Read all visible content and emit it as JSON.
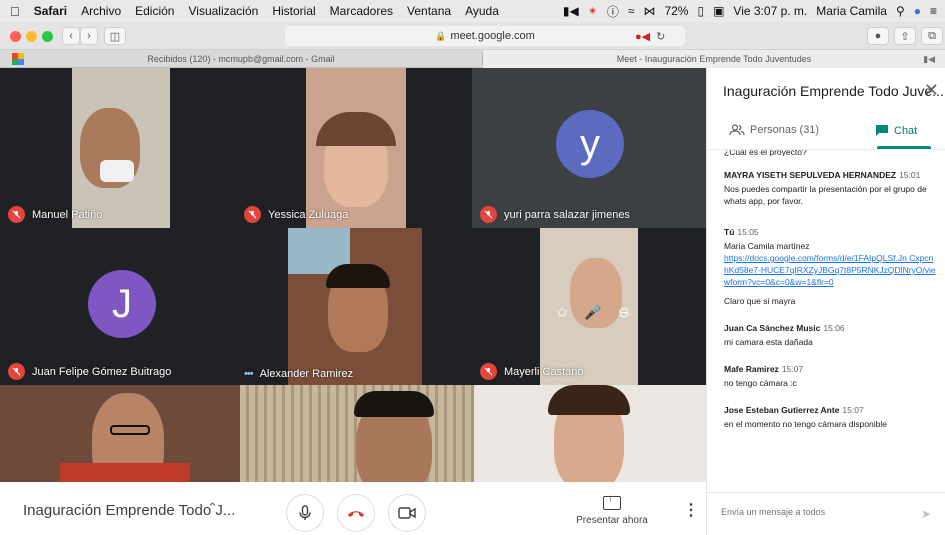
{
  "menubar": {
    "app": "Safari",
    "items": [
      "Archivo",
      "Edición",
      "Visualización",
      "Historial",
      "Marcadores",
      "Ventana",
      "Ayuda"
    ],
    "battery": "72%",
    "time": "Vie 3:07 p. m.",
    "user": "Maria Camila"
  },
  "browser": {
    "url": "meet.google.com",
    "tabs": [
      {
        "label": "Recibidos (120) - mcmupb@gmail.com - Gmail"
      },
      {
        "label": "Meet - Inauguración Emprende Todo Juventudes"
      }
    ]
  },
  "participants": [
    {
      "name": "Manuel Patiño"
    },
    {
      "name": "Yessica Zuluaga"
    },
    {
      "name": "yuri parra salazar jimenes",
      "initial": "y",
      "avatar_color": "#5c6bc0"
    },
    {
      "name": "Juan Felipe Gómez Buitrago",
      "initial": "J",
      "avatar_color": "#7e57c2"
    },
    {
      "name": "Alexander Ramirez"
    },
    {
      "name": "Mayerli Castano"
    }
  ],
  "bottombar": {
    "meeting_title": "Inaguración Emprende Todo J...",
    "present_label": "Presentar ahora"
  },
  "panel": {
    "title": "Inaguración Emprende Todo Juve...",
    "people_tab": "Personas (31)",
    "chat_tab": "Chat",
    "cutoff_text": "¿Cuál es el proyecto?",
    "messages": [
      {
        "sender": "MAYRA YISETH SEPULVEDA HERNANDEZ",
        "time": "15:01",
        "lines": [
          "Nos puedes compartir la presentación por el grupo de whats app, por favor."
        ]
      },
      {
        "sender": "Tú",
        "time": "15:05",
        "lines": [
          "Maria Camila martínez"
        ],
        "link": "https://docs.google.com/forms/d/e/1FAIpQLSf.Jn CxpcnhKd58e7-HUCE7qIRXZyJBGq7t8P5RNKJzQDlNryO/viewform?vc=0&c=0&w=1&flr=0",
        "after": "Claro que si mayra"
      },
      {
        "sender": "Juan Ca Sánchez Music",
        "time": "15:06",
        "lines": [
          "mi camara esta dañada"
        ]
      },
      {
        "sender": "Mafe Ramirez",
        "time": "15:07",
        "lines": [
          "no tengo cámara :c"
        ]
      },
      {
        "sender": "Jose Esteban Gutierrez Ante",
        "time": "15:07",
        "lines": [
          "en el momento no tengo cámara disponible"
        ]
      }
    ],
    "composer_placeholder": "Envía un mensaje a todos"
  }
}
